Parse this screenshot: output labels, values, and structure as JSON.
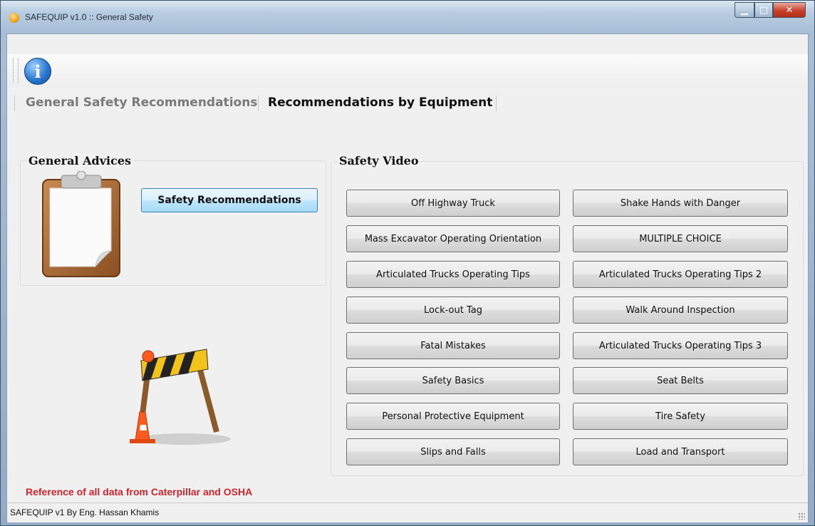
{
  "window": {
    "title": "SAFEQUIP v1.0 :: General Safety",
    "controls": {
      "minimize": "▁",
      "maximize": "□",
      "close": "✕"
    }
  },
  "toolbar": {
    "info_icon": "info-icon",
    "info_glyph": "i"
  },
  "menu": {
    "items": [
      {
        "label": "General Safety Recommendations",
        "active": false
      },
      {
        "label": "Recommendations by Equipment",
        "active": true
      }
    ]
  },
  "general_advices": {
    "title": "General Advices",
    "icon": "clipboard-icon",
    "button": "Safety Recommendations"
  },
  "decoration": {
    "icon": "construction-barrier-icon"
  },
  "safety_video": {
    "title": "Safety Video",
    "left_buttons": [
      "Off Highway Truck",
      "Mass Excavator Operating Orientation",
      "Articulated Trucks Operating Tips",
      "Lock-out Tag",
      "Fatal Mistakes",
      "Safety Basics",
      "Personal Protective Equipment",
      "Slips and Falls"
    ],
    "right_buttons": [
      "Shake Hands with Danger",
      "MULTIPLE CHOICE",
      "Articulated Trucks Operating Tips 2",
      "Walk Around Inspection",
      "Articulated Trucks Operating Tips 3",
      "Seat Belts",
      "Tire Safety",
      "Load and Transport"
    ]
  },
  "reference": "Reference of all data from Caterpillar and OSHA",
  "status": {
    "text": "SAFEQUIP v1 By Eng. Hassan Khamis"
  },
  "colors": {
    "reference_text": "#d2232a",
    "accent_button_border": "#3c7fb1"
  }
}
